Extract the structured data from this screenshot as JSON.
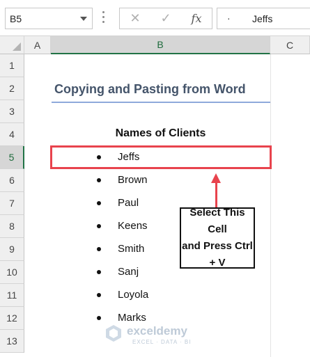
{
  "formula_bar": {
    "name_box": "B5",
    "cancel_glyph": "✕",
    "enter_glyph": "✓",
    "fx_label": "fx",
    "formula_bullet": "·",
    "formula_value": "Jeffs"
  },
  "columns": [
    "A",
    "B",
    "C"
  ],
  "rows": [
    "1",
    "2",
    "3",
    "4",
    "5",
    "6",
    "7",
    "8",
    "9",
    "10",
    "11",
    "12",
    "13"
  ],
  "active_row": "5",
  "sheet": {
    "title": "Copying and Pasting from Word",
    "list_header": "Names of Clients",
    "clients": [
      "Jeffs",
      "Brown",
      "Paul",
      "Keens",
      "Smith",
      "Sanj",
      "Loyola",
      "Marks"
    ]
  },
  "callout": {
    "line1": "Select This Cell",
    "line2": "and Press Ctrl + V"
  },
  "watermark": {
    "name": "exceldemy",
    "tagline": "EXCEL · DATA · BI"
  },
  "colors": {
    "annotation_red": "#e8434d",
    "excel_green": "#217346",
    "title_color": "#44546a",
    "title_underline": "#8ea9db"
  }
}
